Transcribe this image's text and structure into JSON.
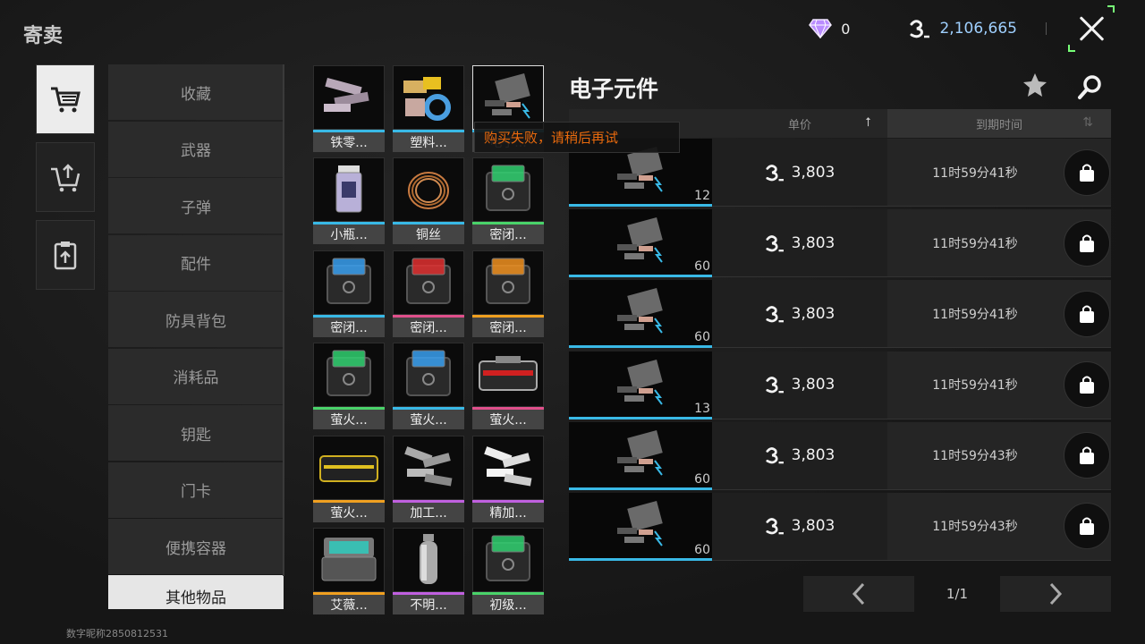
{
  "header": {
    "title": "寄卖",
    "gems": "0",
    "money": "2,106,665"
  },
  "sidebar": {
    "icons": [
      {
        "name": "market-cart-icon",
        "active": true
      },
      {
        "name": "sell-cart-icon",
        "active": false
      },
      {
        "name": "clipboard-icon",
        "active": false
      }
    ],
    "categories": [
      "收藏",
      "武器",
      "子弹",
      "配件",
      "防具背包",
      "消耗品",
      "钥匙",
      "门卡",
      "便携容器",
      "其他物品"
    ],
    "active_category": "其他物品"
  },
  "items": [
    {
      "label": "铁零...",
      "bar": "#39b9e6",
      "icon": "metal-parts"
    },
    {
      "label": "塑料...",
      "bar": "#39b9e6",
      "icon": "plastic-parts"
    },
    {
      "label": "电子...",
      "bar": "#39b9e6",
      "icon": "electronic-parts",
      "selected": true
    },
    {
      "label": "小瓶...",
      "bar": "#39b9e6",
      "icon": "small-bottle"
    },
    {
      "label": "铜丝",
      "bar": "#39b9e6",
      "icon": "copper-wire"
    },
    {
      "label": "密闭...",
      "bar": "#4ad36a",
      "icon": "box-green"
    },
    {
      "label": "密闭...",
      "bar": "#39b9e6",
      "icon": "box-blue"
    },
    {
      "label": "密闭...",
      "bar": "#e0508c",
      "icon": "box-red"
    },
    {
      "label": "密闭...",
      "bar": "#f0a020",
      "icon": "box-orange"
    },
    {
      "label": "萤火...",
      "bar": "#4ad36a",
      "icon": "box-green"
    },
    {
      "label": "萤火...",
      "bar": "#39b9e6",
      "icon": "box-blue"
    },
    {
      "label": "萤火...",
      "bar": "#e0508c",
      "icon": "case-red"
    },
    {
      "label": "萤火...",
      "bar": "#f0a020",
      "icon": "case-yellow"
    },
    {
      "label": "加工...",
      "bar": "#c060e0",
      "icon": "bars-gray"
    },
    {
      "label": "精加...",
      "bar": "#c060e0",
      "icon": "bars-white"
    },
    {
      "label": "艾薇...",
      "bar": "#f0a020",
      "icon": "case-open"
    },
    {
      "label": "不明...",
      "bar": "#c060e0",
      "icon": "gas-tank"
    },
    {
      "label": "初级...",
      "bar": "#4ad36a",
      "icon": "box-green"
    }
  ],
  "panel": {
    "title": "电子元件",
    "col_price": "单价",
    "col_expire": "到期时间",
    "toast": "购买失败，请稍后再试"
  },
  "listings": [
    {
      "qty": "12",
      "price": "3,803",
      "time": "11时59分41秒"
    },
    {
      "qty": "60",
      "price": "3,803",
      "time": "11时59分41秒"
    },
    {
      "qty": "60",
      "price": "3,803",
      "time": "11时59分41秒"
    },
    {
      "qty": "13",
      "price": "3,803",
      "time": "11时59分41秒"
    },
    {
      "qty": "60",
      "price": "3,803",
      "time": "11时59分43秒"
    },
    {
      "qty": "60",
      "price": "3,803",
      "time": "11时59分43秒"
    }
  ],
  "pager": {
    "text": "1/1"
  },
  "footer": {
    "text": "数字昵称2850812531"
  },
  "colors": {
    "accent_cyan": "#39b9e6",
    "toast_orange": "#e96a0d",
    "money_blue": "#9fd0ff"
  }
}
